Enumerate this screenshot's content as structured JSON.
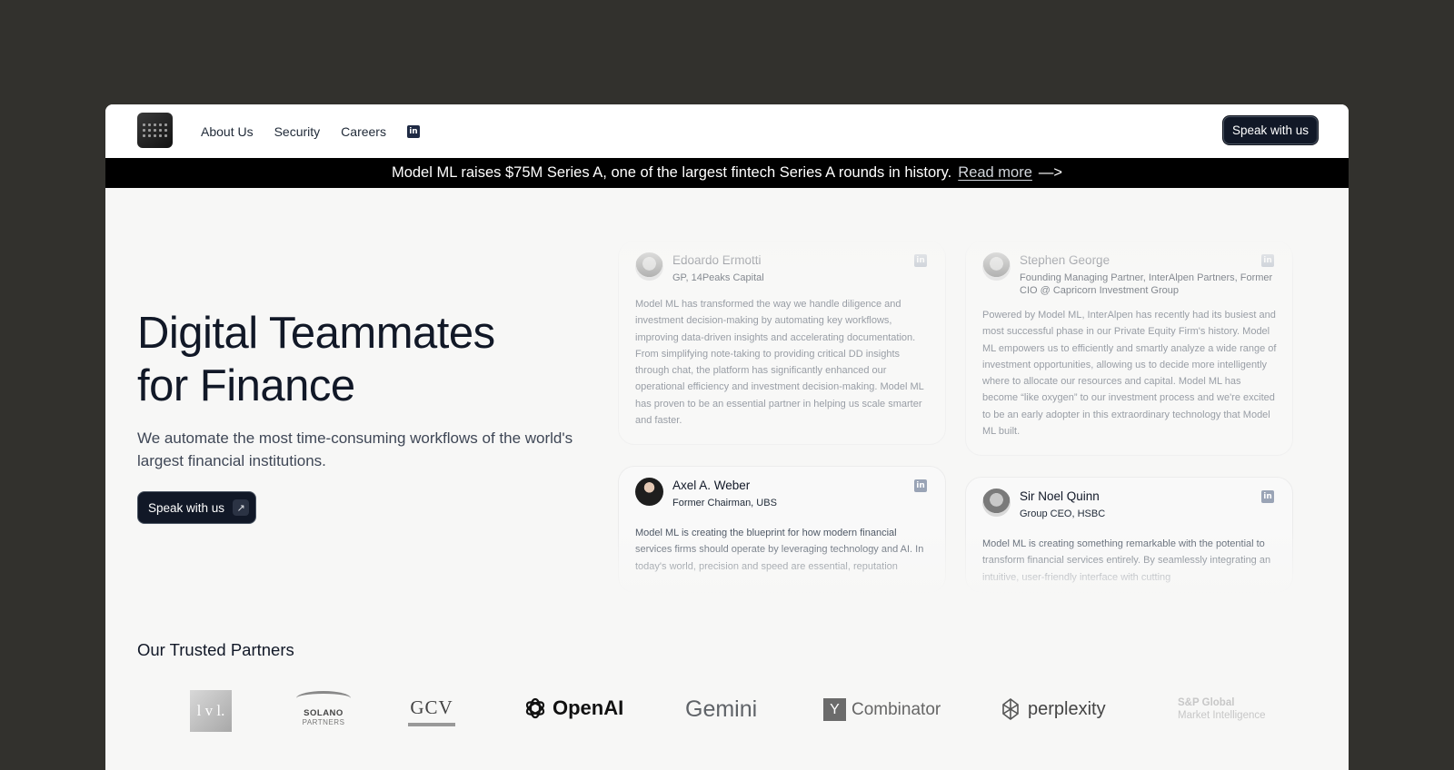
{
  "header": {
    "nav": [
      {
        "label": "About Us"
      },
      {
        "label": "Security"
      },
      {
        "label": "Careers"
      }
    ],
    "linkedin_glyph": "in",
    "cta": "Speak with us"
  },
  "announcement": {
    "text": "Model ML raises $75M Series A, one of the largest fintech Series A rounds in history.",
    "link": "Read more",
    "arrow": "—>"
  },
  "hero": {
    "title_line1": "Digital Teammates",
    "title_line2": "for Finance",
    "subtitle": "We automate the most time-consuming workflows of the world's largest financial institutions.",
    "cta": "Speak with us",
    "cta_icon": "↗"
  },
  "testimonials": [
    {
      "name": "Edoardo Ermotti",
      "role": "GP, 14Peaks Capital",
      "quote": "Model ML has transformed the way we handle diligence and investment decision-making by automating key workflows, improving data-driven insights and accelerating documentation. From simplifying note-taking to providing critical DD insights through chat, the platform has significantly enhanced our operational efficiency and investment decision-making. Model ML has proven to be an essential partner in helping us scale smarter and faster."
    },
    {
      "name": "Stephen George",
      "role": "Founding Managing Partner, InterAlpen Partners, Former CIO @ Capricorn Investment Group",
      "quote": "Powered by Model ML, InterAlpen has recently had its busiest and most successful phase in our Private Equity Firm's history. Model ML empowers us to efficiently and smartly analyze a wide range of investment opportunities, allowing us to decide more intelligently where to allocate our resources and capital. Model ML has become “like oxygen” to our investment process and we're excited to be an early adopter in this extraordinary technology that Model ML built."
    },
    {
      "name": "Axel A. Weber",
      "role": "Former Chairman, UBS",
      "quote": "Model ML is creating the blueprint for how modern financial services firms should operate by leveraging technology and AI. In today's world, precision and speed are essential, reputation"
    },
    {
      "name": "Sir Noel Quinn",
      "role": "Group CEO, HSBC",
      "quote": "Model ML is creating something remarkable with the potential to transform financial services entirely. By seamlessly integrating an intuitive, user-friendly interface with cutting"
    }
  ],
  "partners": {
    "title": "Our Trusted Partners",
    "logos": [
      {
        "name": "lvl-logo",
        "text": "l v l."
      },
      {
        "name": "solano-logo",
        "text": "SOLANO",
        "sub": "PARTNERS"
      },
      {
        "name": "gcv-logo",
        "text": "GCV"
      },
      {
        "name": "openai-logo",
        "text": "OpenAI"
      },
      {
        "name": "gemini-logo",
        "text": "Gemini"
      },
      {
        "name": "ycombinator-logo",
        "mark": "Y",
        "text": "Combinator"
      },
      {
        "name": "perplexity-logo",
        "text": "perplexity"
      },
      {
        "name": "sp-global-logo",
        "text": "S&P Global",
        "sub": "Market Intelligence"
      }
    ]
  },
  "colors": {
    "backdrop": "#32312d",
    "page": "#f7f7f6",
    "button": "#111827",
    "banner": "#000000"
  }
}
